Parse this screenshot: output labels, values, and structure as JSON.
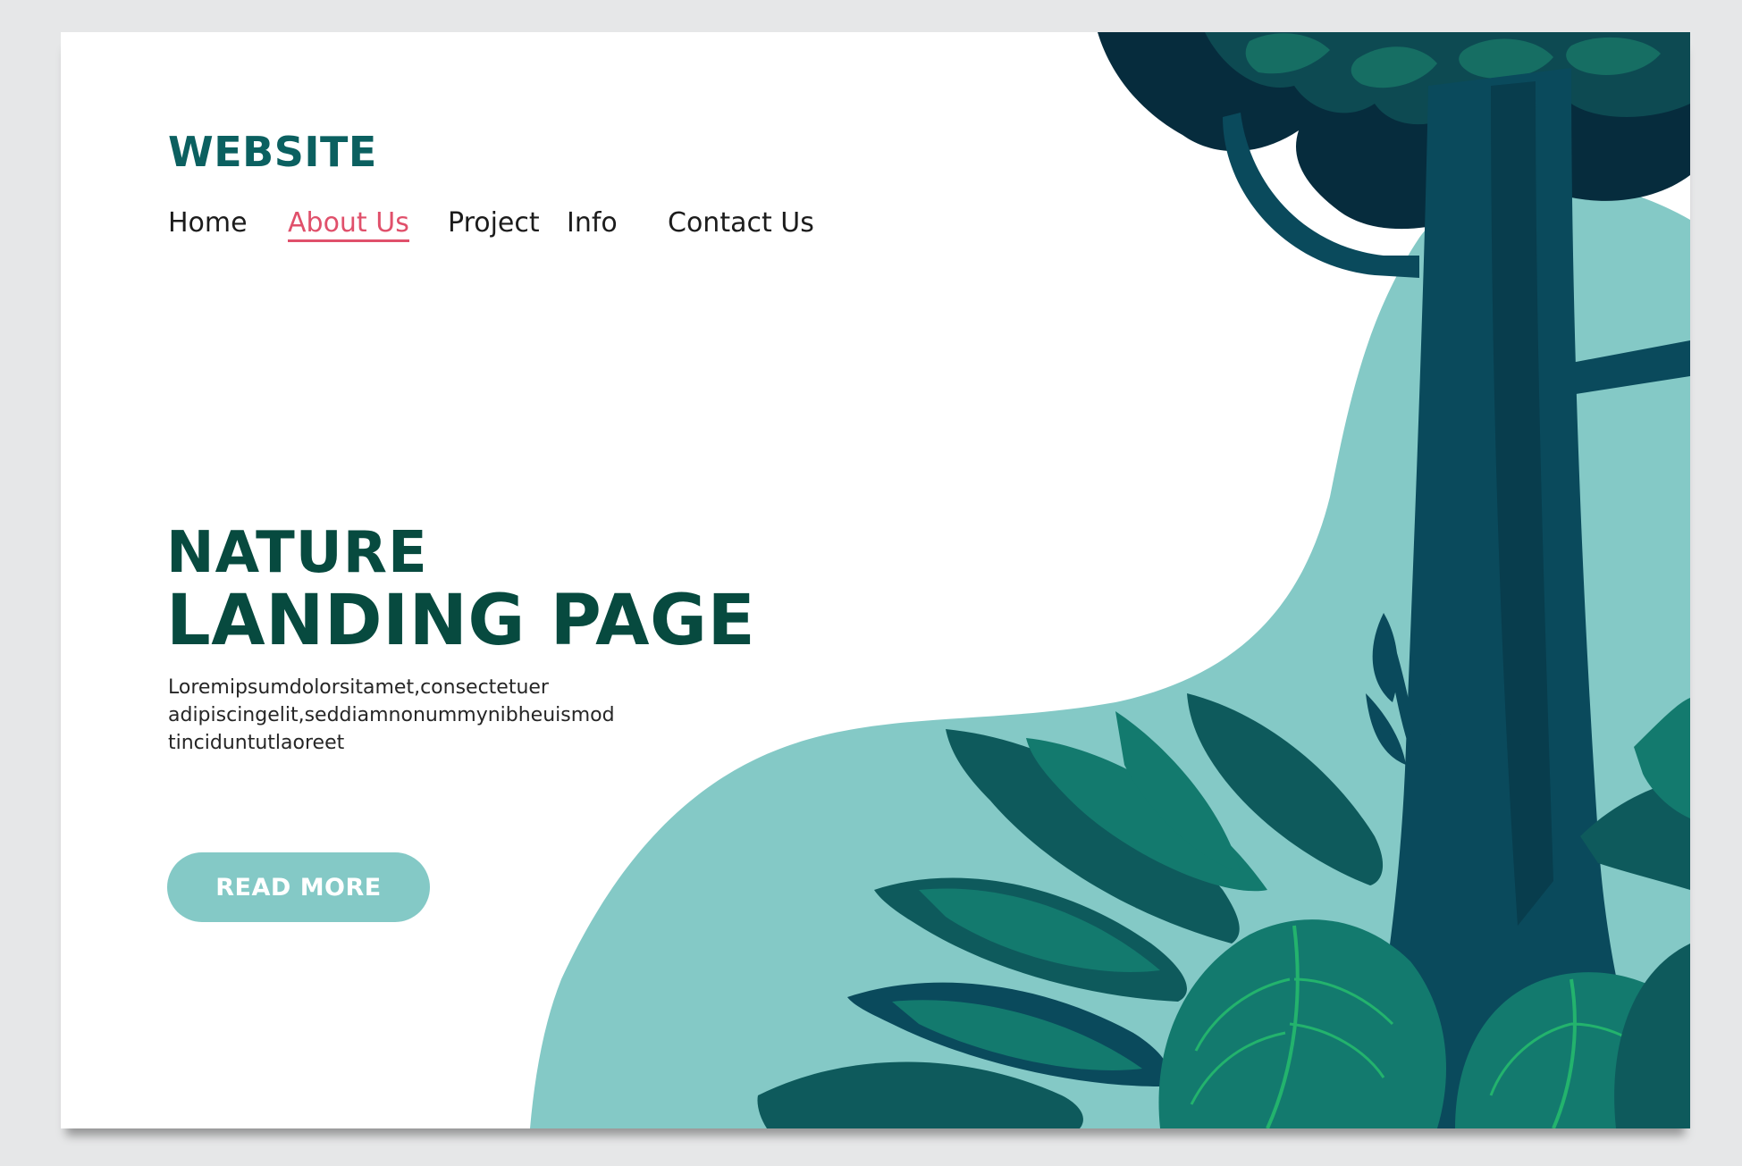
{
  "brand": {
    "logo_text": "WEBSITE"
  },
  "nav": {
    "items": [
      {
        "label": "Home",
        "active": false
      },
      {
        "label": "About Us",
        "active": true
      },
      {
        "label": "Project",
        "active": false
      },
      {
        "label": "Info",
        "active": false
      },
      {
        "label": "Contact Us",
        "active": false
      }
    ]
  },
  "hero": {
    "title_line1": "NATURE",
    "title_line2": "LANDING PAGE",
    "body_lines": [
      "Loremipsumdolorsitamet,consectetuer",
      "adipiscingelit,seddiamnonummynibheuismod",
      "tinciduntutlaoreet"
    ],
    "cta_label": "READ MORE"
  },
  "colors": {
    "brand": "#0b6060",
    "heading": "#074a3f",
    "nav_active": "#e0506b",
    "button": "#84c9c6",
    "blob": "#84c9c6",
    "tree": "#0a4a5c",
    "leaves_dark": "#0e5a5c",
    "leaves_mid": "#137a6e",
    "leaves_bright": "#23b36d",
    "page_background": "#e6e7e8"
  }
}
